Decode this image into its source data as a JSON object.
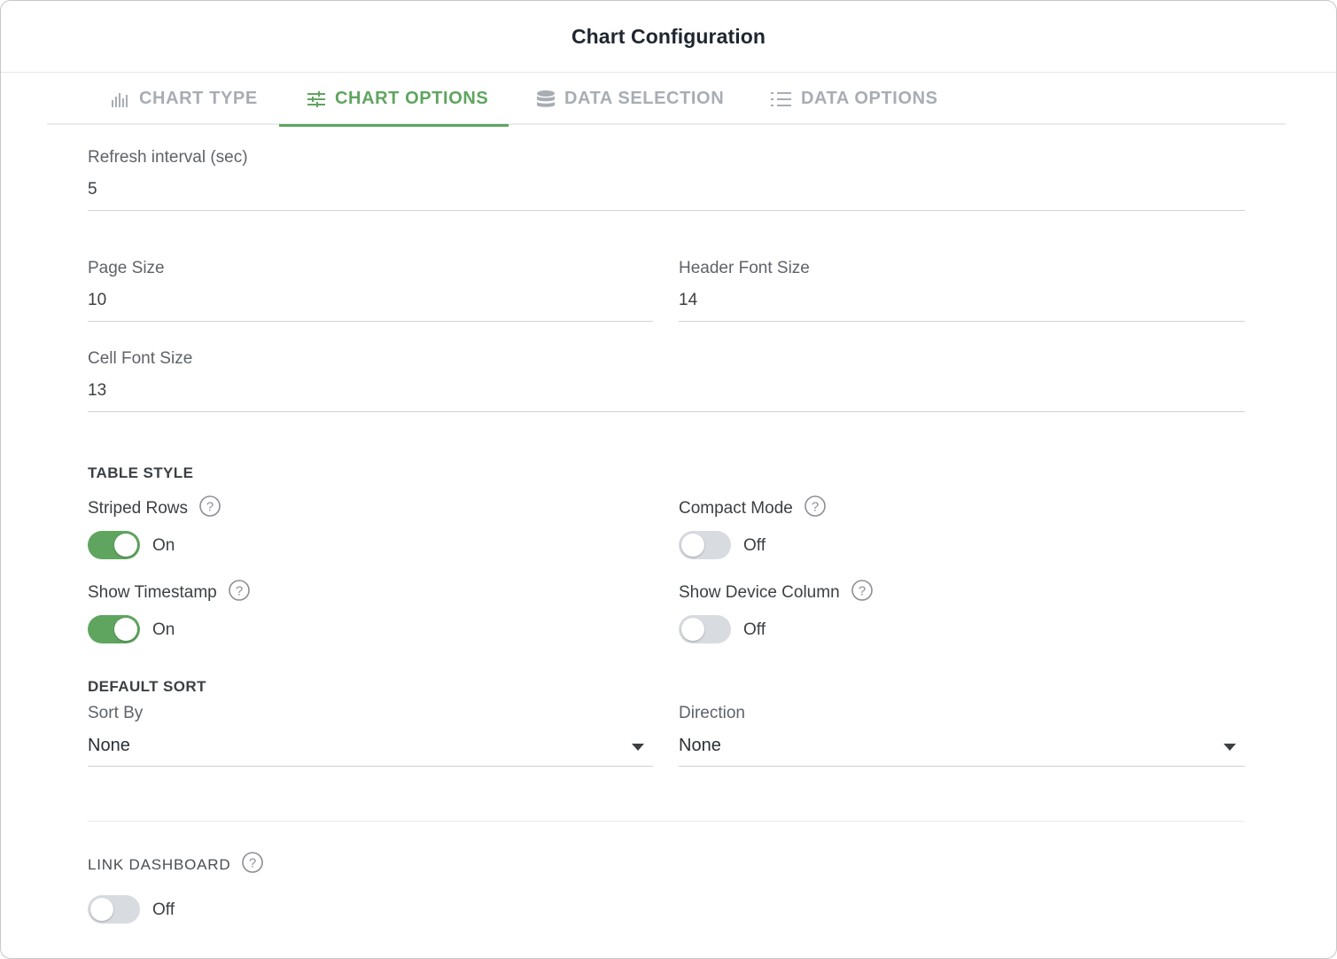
{
  "dialog": {
    "title": "Chart Configuration"
  },
  "tabs": [
    {
      "label": "CHART TYPE",
      "icon": "bar-chart-icon",
      "active": false
    },
    {
      "label": "CHART OPTIONS",
      "icon": "sliders-icon",
      "active": true
    },
    {
      "label": "DATA SELECTION",
      "icon": "database-icon",
      "active": false
    },
    {
      "label": "DATA OPTIONS",
      "icon": "list-numbered-icon",
      "active": false
    }
  ],
  "fields": {
    "refresh_interval": {
      "label": "Refresh interval (sec)",
      "value": "5"
    },
    "page_size": {
      "label": "Page Size",
      "value": "10"
    },
    "header_font_size": {
      "label": "Header Font Size",
      "value": "14"
    },
    "cell_font_size": {
      "label": "Cell Font Size",
      "value": "13"
    }
  },
  "table_style": {
    "title": "TABLE STYLE",
    "striped_rows": {
      "label": "Striped Rows",
      "state": "On",
      "enabled": true
    },
    "compact_mode": {
      "label": "Compact Mode",
      "state": "Off",
      "enabled": false
    },
    "show_timestamp": {
      "label": "Show Timestamp",
      "state": "On",
      "enabled": true
    },
    "show_device_column": {
      "label": "Show Device Column",
      "state": "Off",
      "enabled": false
    }
  },
  "default_sort": {
    "title": "DEFAULT SORT",
    "sort_by": {
      "label": "Sort By",
      "value": "None"
    },
    "direction": {
      "label": "Direction",
      "value": "None"
    }
  },
  "link_dashboard": {
    "title": "LINK DASHBOARD",
    "state": "Off",
    "enabled": false
  },
  "colors": {
    "accent": "#5fa55f",
    "toggle_off": "#d8dbe0",
    "muted_tab": "#a8adb4"
  }
}
